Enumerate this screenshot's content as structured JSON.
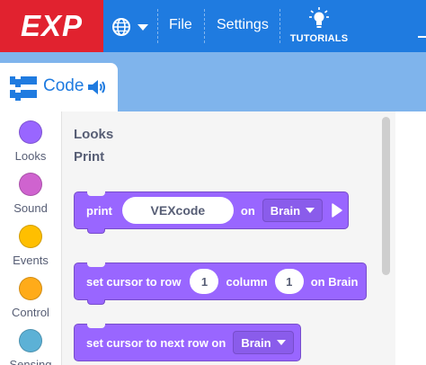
{
  "header": {
    "logo_text": "EXP",
    "menu": {
      "file": "File",
      "settings": "Settings",
      "tutorials": "TUTORIALS"
    },
    "icons": {
      "language": "globe-icon",
      "tutorials": "lightbulb-icon"
    }
  },
  "code_tab": {
    "label": "Code",
    "icons": [
      "code-blocks-icon",
      "speaker-icon"
    ]
  },
  "categories": [
    {
      "label": "Looks",
      "color": "#9966ff"
    },
    {
      "label": "Sound",
      "color": "#cf63cf"
    },
    {
      "label": "Events",
      "color": "#ffbf00"
    },
    {
      "label": "Control",
      "color": "#ffab19"
    },
    {
      "label": "Sensing",
      "color": "#5cb1d6"
    }
  ],
  "flyout": {
    "section": "Looks",
    "subsection": "Print",
    "blocks": {
      "print": {
        "word": "print",
        "value": "VEXcode",
        "on": "on",
        "target": "Brain"
      },
      "set_cursor": {
        "lead": "set cursor to row",
        "row": "1",
        "column_word": "column",
        "column": "1",
        "tail": "on Brain"
      },
      "next_row": {
        "lead": "set cursor to next row on",
        "target": "Brain"
      }
    }
  },
  "colors": {
    "topbar": "#1f7be0",
    "logo": "#e1222f",
    "band": "#7fb4ec",
    "looks_block": "#9966ff"
  }
}
